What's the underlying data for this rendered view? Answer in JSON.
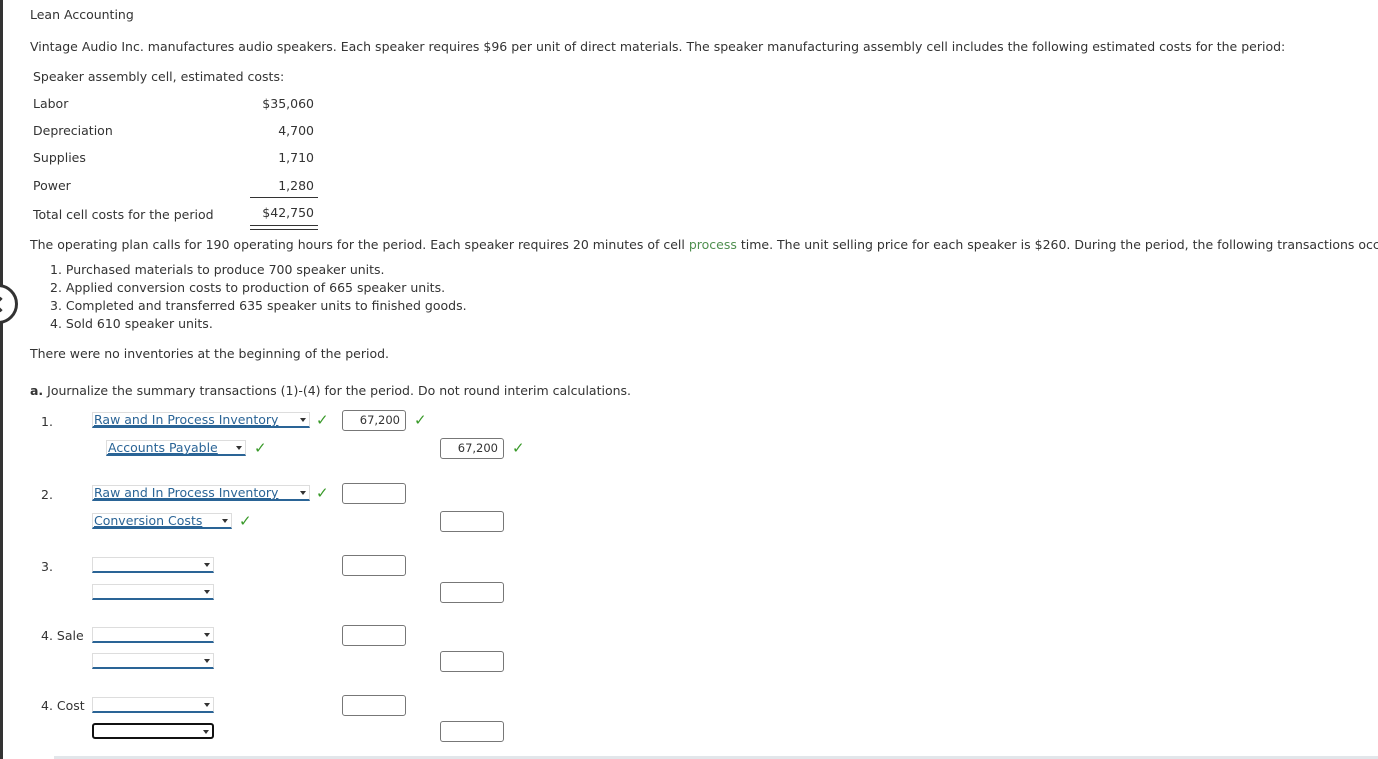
{
  "title": "Lean Accounting",
  "intro": "Vintage Audio Inc. manufactures audio speakers. Each speaker requires $96 per unit of direct materials. The speaker manufacturing assembly cell includes the following estimated costs for the period:",
  "cost_table": {
    "title": "Speaker assembly cell, estimated costs:",
    "rows": [
      {
        "label": "Labor",
        "value": "$35,060"
      },
      {
        "label": "Depreciation",
        "value": "4,700"
      },
      {
        "label": "Supplies",
        "value": "1,710"
      },
      {
        "label": "Power",
        "value": "1,280"
      }
    ],
    "total": {
      "label": "Total cell costs for the period",
      "value": "$42,750"
    }
  },
  "plan": {
    "before_link": "The operating plan calls for 190 operating hours for the period. Each speaker requires 20 minutes of cell ",
    "link": "process",
    "after_link": " time. The unit selling price for each speaker is $260. During the period, the following transactions occurred:"
  },
  "transactions": [
    "1. Purchased materials to produce 700 speaker units.",
    "2. Applied conversion costs to production of 665 speaker units.",
    "3. Completed and transferred 635 speaker units to finished goods.",
    "4. Sold 610 speaker units."
  ],
  "no_inventory_note": "There were no inventories at the beginning of the period.",
  "question": {
    "letter": "a.",
    "text": " Journalize the summary transactions (1)-(4) for the period. Do not round interim calculations."
  },
  "journal": {
    "check_glyph": "✓",
    "entries": [
      {
        "label": "1.",
        "debit_account": "Raw and In Process Inventory",
        "debit_amount": "67,200",
        "credit_account": "Accounts Payable",
        "credit_amount": "67,200"
      },
      {
        "label": "2.",
        "debit_account": "Raw and In Process Inventory",
        "debit_amount": "",
        "credit_account": "Conversion Costs",
        "credit_amount": ""
      },
      {
        "label": "3.",
        "debit_account": "",
        "debit_amount": "",
        "credit_account": "",
        "credit_amount": ""
      },
      {
        "label": "4. Sale",
        "debit_account": "",
        "debit_amount": "",
        "credit_account": "",
        "credit_amount": ""
      },
      {
        "label": "4. Cost",
        "debit_account": "",
        "debit_amount": "",
        "credit_account": "",
        "credit_amount": ""
      }
    ]
  }
}
